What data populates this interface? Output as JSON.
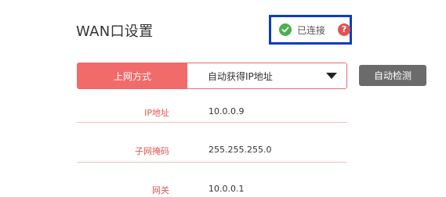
{
  "header": {
    "title": "WAN口设置"
  },
  "status": {
    "text": "已连接",
    "help_glyph": "?",
    "color_ok": "#4caf50",
    "color_help": "#e05454"
  },
  "connection": {
    "label": "上网方式",
    "selected": "自动获得IP地址",
    "accent": "#f26b6b"
  },
  "detect_button": {
    "label": "自动检测"
  },
  "fields": [
    {
      "label": "IP地址",
      "value": "10.0.0.9"
    },
    {
      "label": "子网掩码",
      "value": "255.255.255.0"
    },
    {
      "label": "网关",
      "value": "10.0.0.1"
    }
  ]
}
